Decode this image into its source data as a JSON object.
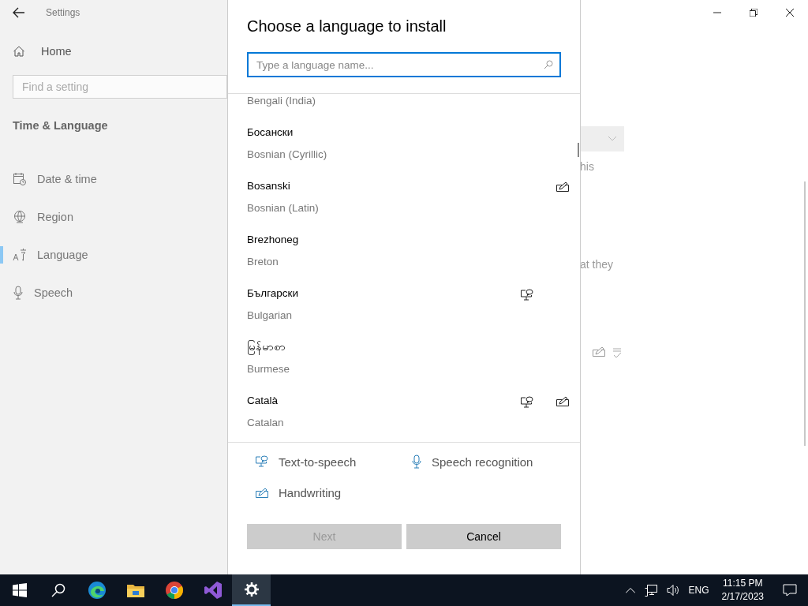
{
  "window": {
    "title": "Settings"
  },
  "sidebar": {
    "home": "Home",
    "search": {
      "placeholder": "Find a setting"
    },
    "section": "Time & Language",
    "items": [
      {
        "label": "Date & time",
        "selected": false
      },
      {
        "label": "Region",
        "selected": false
      },
      {
        "label": "Language",
        "selected": true
      },
      {
        "label": "Speech",
        "selected": false
      }
    ]
  },
  "background": {
    "fragments": [
      "his",
      "at they"
    ]
  },
  "dialog": {
    "title": "Choose a language to install",
    "search": {
      "placeholder": "Type a language name..."
    },
    "languages": [
      {
        "english": "Bengali (India)",
        "tts": false,
        "handwriting": false
      },
      {
        "native": "Босански",
        "english": "Bosnian (Cyrillic)",
        "tts": false,
        "handwriting": false
      },
      {
        "native": "Bosanski",
        "english": "Bosnian (Latin)",
        "tts": false,
        "handwriting": true
      },
      {
        "native": "Brezhoneg",
        "english": "Breton",
        "tts": false,
        "handwriting": false
      },
      {
        "native": "Български",
        "english": "Bulgarian",
        "tts": true,
        "handwriting": false
      },
      {
        "native": "မြန်မာစာ",
        "english": "Burmese",
        "tts": false,
        "handwriting": false
      },
      {
        "native": "Català",
        "english": "Catalan",
        "tts": true,
        "handwriting": true
      }
    ],
    "legend": [
      {
        "label": "Text-to-speech"
      },
      {
        "label": "Speech recognition"
      },
      {
        "label": "Handwriting"
      }
    ],
    "buttons": [
      {
        "label": "Next",
        "disabled": true
      },
      {
        "label": "Cancel",
        "disabled": false
      }
    ]
  },
  "taskbar": {
    "apps": [
      {
        "active": false
      },
      {
        "active": false
      },
      {
        "active": false
      },
      {
        "active": false
      },
      {
        "active": false
      },
      {
        "active": true
      }
    ],
    "language": "ENG",
    "time": "11:15 PM",
    "date": "2/17/2023"
  }
}
